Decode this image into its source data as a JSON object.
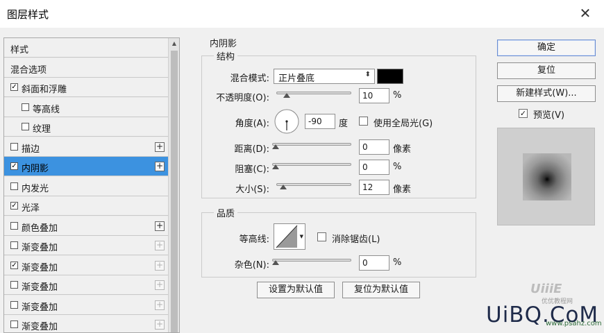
{
  "window": {
    "title": "图层样式"
  },
  "style_list": [
    {
      "label": "样式",
      "checkbox": false,
      "checked": false,
      "indent": 0,
      "add_button": "none",
      "selected": false
    },
    {
      "label": "混合选项",
      "checkbox": false,
      "checked": false,
      "indent": 0,
      "add_button": "none",
      "selected": false
    },
    {
      "label": "斜面和浮雕",
      "checkbox": true,
      "checked": true,
      "indent": 0,
      "add_button": "none",
      "selected": false
    },
    {
      "label": "等高线",
      "checkbox": true,
      "checked": false,
      "indent": 1,
      "add_button": "none",
      "selected": false
    },
    {
      "label": "纹理",
      "checkbox": true,
      "checked": false,
      "indent": 1,
      "add_button": "none",
      "selected": false
    },
    {
      "label": "描边",
      "checkbox": true,
      "checked": false,
      "indent": 0,
      "add_button": "active",
      "selected": false
    },
    {
      "label": "内阴影",
      "checkbox": true,
      "checked": true,
      "indent": 0,
      "add_button": "active",
      "selected": true
    },
    {
      "label": "内发光",
      "checkbox": true,
      "checked": false,
      "indent": 0,
      "add_button": "none",
      "selected": false
    },
    {
      "label": "光泽",
      "checkbox": true,
      "checked": true,
      "indent": 0,
      "add_button": "none",
      "selected": false
    },
    {
      "label": "颜色叠加",
      "checkbox": true,
      "checked": false,
      "indent": 0,
      "add_button": "active",
      "selected": false
    },
    {
      "label": "渐变叠加",
      "checkbox": true,
      "checked": false,
      "indent": 0,
      "add_button": "dim",
      "selected": false
    },
    {
      "label": "渐变叠加",
      "checkbox": true,
      "checked": true,
      "indent": 0,
      "add_button": "dim",
      "selected": false
    },
    {
      "label": "渐变叠加",
      "checkbox": true,
      "checked": false,
      "indent": 0,
      "add_button": "dim",
      "selected": false
    },
    {
      "label": "渐变叠加",
      "checkbox": true,
      "checked": false,
      "indent": 0,
      "add_button": "dim",
      "selected": false
    },
    {
      "label": "渐变叠加",
      "checkbox": true,
      "checked": false,
      "indent": 0,
      "add_button": "dim",
      "selected": false
    }
  ],
  "panel": {
    "title": "内阴影",
    "structure": {
      "legend": "结构",
      "blend_mode_label": "混合模式:",
      "blend_mode_value": "正片叠底",
      "shadow_color": "#000000",
      "opacity_label": "不透明度(O):",
      "opacity_value": "10",
      "opacity_unit": "%",
      "opacity_level_percent": 10,
      "angle_label": "角度(A):",
      "angle_value": "-90",
      "angle_unit": "度",
      "global_light_label": "使用全局光(G)",
      "global_light_checked": false,
      "distance_label": "距离(D):",
      "distance_value": "0",
      "distance_unit": "像素",
      "distance_level_percent": 0,
      "choke_label": "阻塞(C):",
      "choke_value": "0",
      "choke_unit": "%",
      "choke_level_percent": 0,
      "size_label": "大小(S):",
      "size_value": "12",
      "size_unit": "像素",
      "size_level_percent": 5
    },
    "quality": {
      "legend": "品质",
      "contour_label": "等高线:",
      "antialias_label": "消除锯齿(L)",
      "antialias_checked": false,
      "noise_label": "杂色(N):",
      "noise_value": "0",
      "noise_unit": "%",
      "noise_level_percent": 0
    },
    "set_default_label": "设置为默认值",
    "reset_default_label": "复位为默认值"
  },
  "actions": {
    "ok_label": "确定",
    "reset_label": "复位",
    "new_style_label": "新建样式(W)...",
    "preview_label": "预览(V)",
    "preview_checked": true
  },
  "watermark": {
    "brand": "UiBQ.CoM",
    "tag": "UiiiE",
    "tag_sub": "优优教程网",
    "url": "www.psahz.com"
  }
}
